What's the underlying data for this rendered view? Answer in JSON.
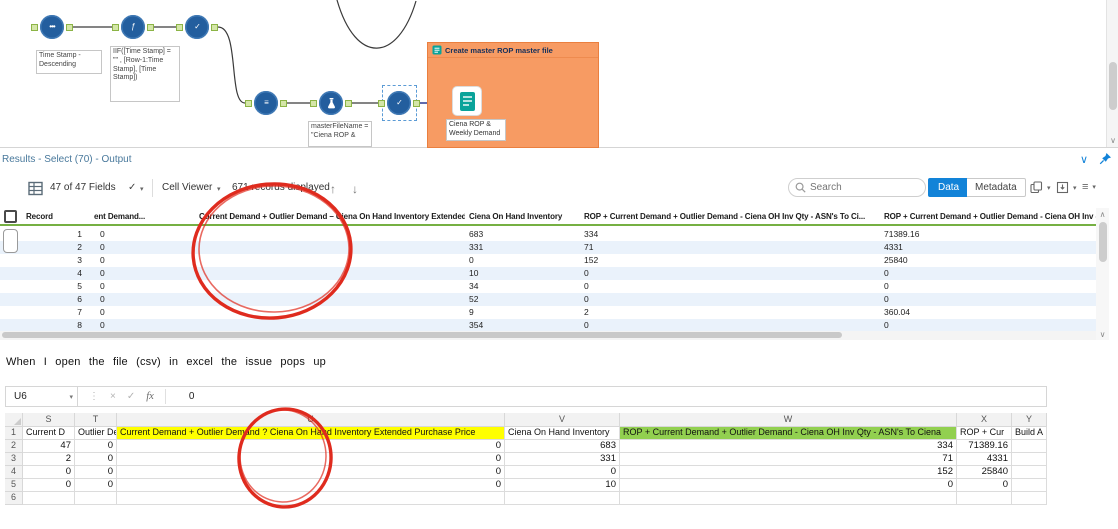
{
  "icons": {
    "caret_down": "▾",
    "chevron_down": "∨",
    "scroll_down": "∨",
    "scroll_up": "∧",
    "up_arrow": "↑",
    "down_arrow": "↓",
    "check": "✓",
    "dots_vertical": "⋮",
    "close": "×",
    "menu": "≡",
    "tool_sort_glyph": "•••",
    "tool_formula_glyph": "ƒ",
    "tool_select_glyph": "✓",
    "tool_union_glyph": "≡"
  },
  "canvas": {
    "annotations": {
      "sort": "Time Stamp - Descending",
      "formula": "IIF([Time Stamp] = \"\" , [Row-1:Time Stamp], [Time Stamp])",
      "master_file": "masterFileName = \"Ciena ROP &"
    },
    "container": {
      "title": "Create master ROP master file",
      "tool_caption": "Ciena ROP & Weekly Demand"
    }
  },
  "results": {
    "title": "Results - Select (70) - Output",
    "fields_summary": "47 of 47 Fields",
    "cell_viewer_label": "Cell Viewer",
    "records_summary": "671 records displayed",
    "search_placeholder": "Search",
    "data_button": "Data",
    "metadata_button": "Metadata",
    "columns": [
      "Record",
      "ent Demand...",
      "Current Demand + Outlier Demand – Ciena On Hand Inventory Extended Purchase Price",
      "Ciena On Hand Inventory",
      "ROP + Current Demand + Outlier Demand - Ciena OH Inv Qty - ASN's To Ci...",
      "ROP + Current Demand + Outlier Demand - Ciena OH Inv - ..."
    ],
    "rows": [
      [
        "1",
        "0",
        "",
        "683",
        "334",
        "71389.16"
      ],
      [
        "2",
        "0",
        "",
        "331",
        "71",
        "4331"
      ],
      [
        "3",
        "0",
        "",
        "0",
        "152",
        "25840"
      ],
      [
        "4",
        "0",
        "",
        "10",
        "0",
        "0"
      ],
      [
        "5",
        "0",
        "",
        "34",
        "0",
        "0"
      ],
      [
        "6",
        "0",
        "",
        "52",
        "0",
        "0"
      ],
      [
        "7",
        "0",
        "",
        "9",
        "2",
        "360.04"
      ],
      [
        "8",
        "0",
        "",
        "354",
        "0",
        "0"
      ]
    ]
  },
  "note": "When I open the file (csv) in excel the issue pops up",
  "excel": {
    "name_box": "U6",
    "fx_label": "fx",
    "formula_value": "0",
    "col_letters": [
      "S",
      "T",
      "U",
      "V",
      "W",
      "X",
      "Y"
    ],
    "grid": [
      [
        "Current D",
        "Outlier De",
        "Current Demand + Outlier Demand ? Ciena On Hand Inventory Extended Purchase Price",
        "Ciena On Hand Inventory",
        "ROP + Current Demand + Outlier Demand - Ciena OH Inv Qty - ASN's To Ciena",
        "ROP + Cur",
        "Build A"
      ],
      [
        "47",
        "0",
        "0",
        "683",
        "334",
        "71389.16",
        ""
      ],
      [
        "2",
        "0",
        "0",
        "331",
        "71",
        "4331",
        ""
      ],
      [
        "0",
        "0",
        "0",
        "0",
        "152",
        "25840",
        ""
      ],
      [
        "0",
        "0",
        "0",
        "10",
        "0",
        "0",
        ""
      ],
      [
        "",
        "",
        "",
        "",
        "",
        "",
        ""
      ]
    ]
  },
  "colors": {
    "accent_blue": "#1283d8",
    "alteryx_green": "#76b043",
    "container_orange": "#f79b63",
    "teal": "#0aa39a",
    "highlight_yellow": "#ffff00",
    "highlight_green": "#92d050",
    "annotation_red": "#df2b1e"
  }
}
